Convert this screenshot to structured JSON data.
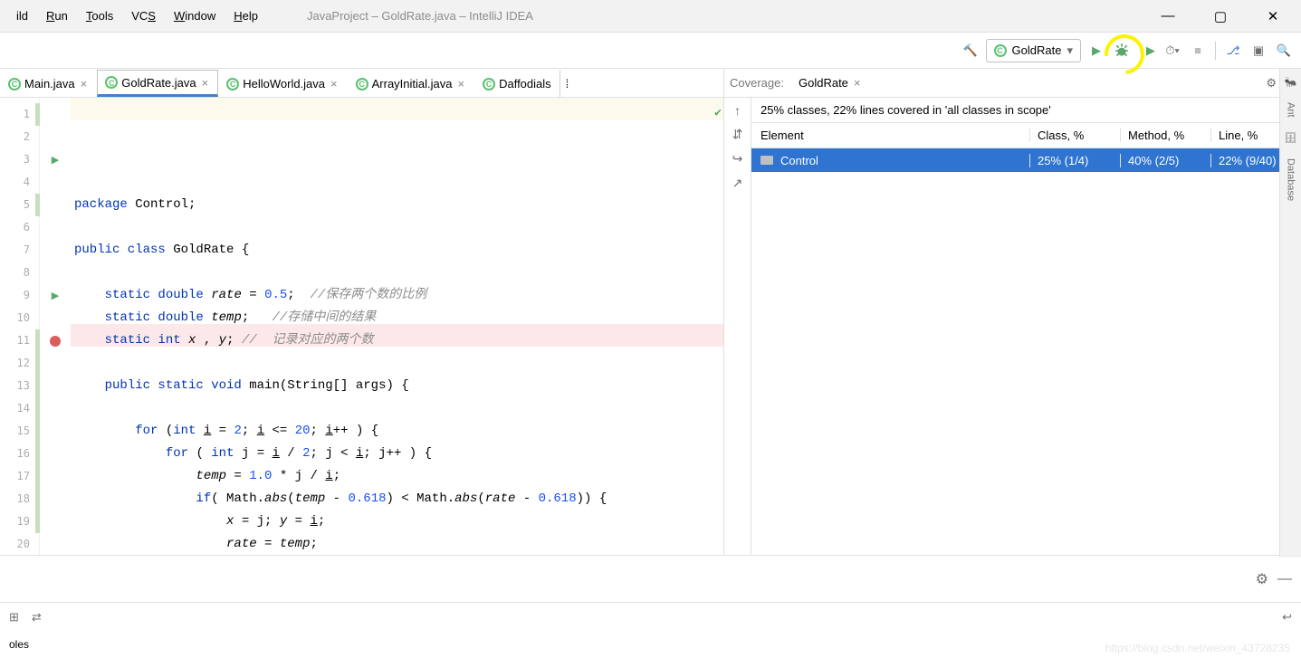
{
  "menu": {
    "items": [
      "ild",
      "Run",
      "Tools",
      "VCS",
      "Window",
      "Help"
    ]
  },
  "title": "JavaProject – GoldRate.java – IntelliJ IDEA",
  "run_config": "GoldRate",
  "tabs": [
    {
      "label": "Main.java",
      "active": false
    },
    {
      "label": "GoldRate.java",
      "active": true
    },
    {
      "label": "HelloWorld.java",
      "active": false
    },
    {
      "label": "ArrayInitial.java",
      "active": false
    },
    {
      "label": "Daffodials",
      "active": false,
      "truncated": true
    }
  ],
  "code": {
    "lines": [
      "package Control;",
      "",
      "public class GoldRate {",
      "",
      "    static double rate = 0.5;  //保存两个数的比例",
      "    static double temp;   //存储中间的结果",
      "    static int x , y; //  记录对应的两个数",
      "",
      "    public static void main(String[] args) {",
      "",
      "        for (int i = 2; i <= 20; i++ ) {",
      "            for ( int j = i / 2; j < i; j++ ) {",
      "                temp = 1.0 * j / i;",
      "                if( Math.abs(temp - 0.618) < Math.abs(rate - 0.618)) {",
      "                    x = j; y = i;",
      "                    rate = temp;",
      "                }",
      "            }",
      "        }",
      ""
    ]
  },
  "coverage": {
    "title": "Coverage:",
    "run": "GoldRate",
    "summary": "25% classes, 22% lines covered in 'all classes in scope'",
    "headers": {
      "element": "Element",
      "class": "Class, %",
      "method": "Method, %",
      "line": "Line, %"
    },
    "rows": [
      {
        "element": "Control",
        "class": "25% (1/4)",
        "method": "40% (2/5)",
        "line": "22% (9/40)"
      }
    ]
  },
  "rail": {
    "ant": "Ant",
    "database": "Database"
  },
  "status": "oles"
}
